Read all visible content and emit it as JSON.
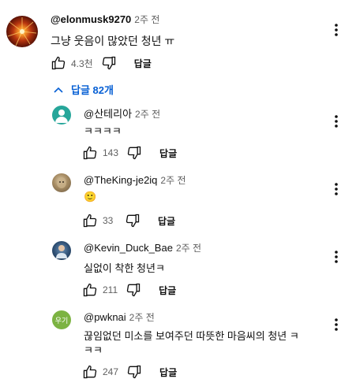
{
  "main_comment": {
    "author": "@elonmusk9270",
    "time": "2주 전",
    "text": "그냥 웃음이 많았던 청년 ㅠ",
    "likes": "4.3천",
    "reply_label": "답글"
  },
  "replies_toggle": {
    "label": "답글 82개"
  },
  "replies": [
    {
      "author": "@산테리아",
      "time": "2주 전",
      "text": "ㅋㅋㅋㅋ",
      "likes": "143",
      "reply_label": "답글"
    },
    {
      "author": "@TheKing-je2iq",
      "time": "2주 전",
      "text": "🙂",
      "likes": "33",
      "reply_label": "답글"
    },
    {
      "author": "@Kevin_Duck_Bae",
      "time": "2주 전",
      "text": "실없이 착한 청년ㅋ",
      "likes": "211",
      "reply_label": "답글"
    },
    {
      "author": "@pwknai",
      "time": "2주 전",
      "text_line1": "끊임없던 미소를 보여주던 따뜻한 마음씨의 청년 ㅋ",
      "text_line2": "ㅋㅋ",
      "likes": "247",
      "reply_label": "답글",
      "avatar_text": "우기"
    }
  ],
  "colors": {
    "link": "#065fd4",
    "secondary_text": "#606060",
    "avatar_teal": "#26a69a",
    "avatar_green": "#7cb342"
  }
}
